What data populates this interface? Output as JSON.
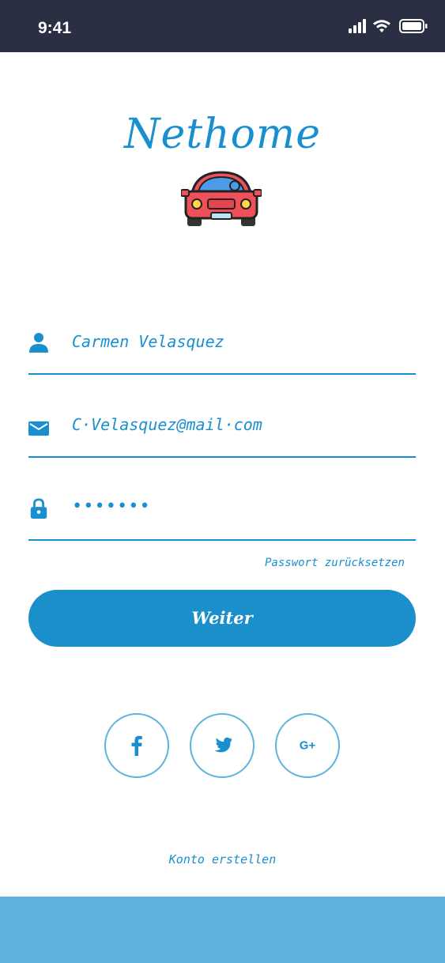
{
  "status_bar": {
    "time": "9:41"
  },
  "brand": {
    "name": "Nethome"
  },
  "form": {
    "name_value": "Carmen Velasquez",
    "email_value": "C·Velasquez@mail·com",
    "password_value": "•••••••",
    "reset_label": "Passwort zurücksetzen",
    "submit_label": "Weiter"
  },
  "social": [
    {
      "name": "facebook",
      "label": "f"
    },
    {
      "name": "twitter",
      "label": "twitter"
    },
    {
      "name": "google-plus",
      "label": "G+"
    }
  ],
  "footer": {
    "create_account_label": "Konto erstellen"
  },
  "colors": {
    "accent": "#1a8fd0",
    "status_bar": "#2b2f44",
    "band": "#5eb3dc"
  }
}
